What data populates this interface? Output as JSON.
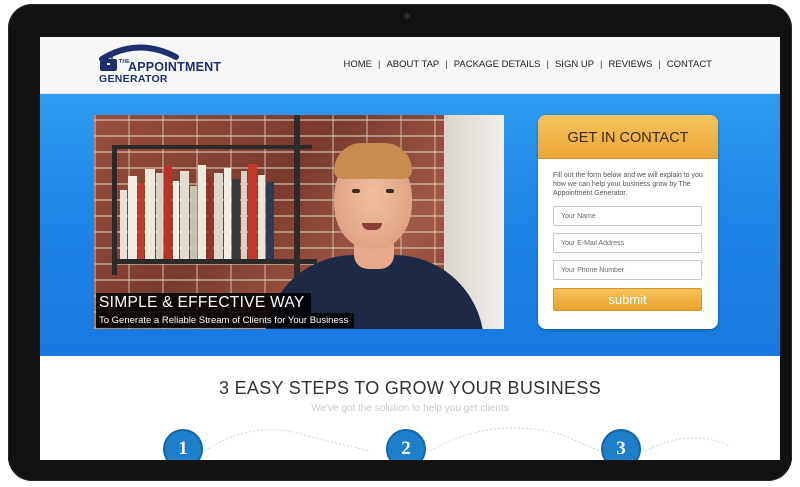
{
  "logo": {
    "small": "THE",
    "line1": "APPOINTMENT",
    "line2": "GENERATOR",
    "colors": {
      "navy": "#1f2f6e",
      "arc": "#1f2f6e"
    }
  },
  "nav": {
    "items": [
      {
        "label": "HOME"
      },
      {
        "label": "ABOUT TAP"
      },
      {
        "label": "PACKAGE DETAILS"
      },
      {
        "label": "SIGN UP"
      },
      {
        "label": "REVIEWS"
      },
      {
        "label": "CONTACT"
      }
    ],
    "separator": "|"
  },
  "video": {
    "caption_title": "SIMPLE & EFFECTIVE WAY",
    "caption_sub": "To Generate a Reliable Stream of Clients for Your Business"
  },
  "contact": {
    "title": "GET IN CONTACT",
    "description": "Fill out the form below and we will explain to you how we can help your business grow by The Appointment Generator.",
    "fields": {
      "name": {
        "placeholder": "Your Name",
        "value": ""
      },
      "email": {
        "placeholder": "Your E-Mail Address",
        "value": ""
      },
      "phone": {
        "placeholder": "Your Phone Number",
        "value": ""
      }
    },
    "submit_label": "submit"
  },
  "steps": {
    "title": "3 EASY STEPS TO GROW YOUR BUSINESS",
    "subtitle": "We've got the solution to help you get clients",
    "numbers": [
      "1",
      "2",
      "3"
    ]
  },
  "colors": {
    "hero_blue": "#1f86e6",
    "accent_orange": "#eba53a",
    "step_blue": "#1d7fc9",
    "device_bezel": "#111214"
  }
}
